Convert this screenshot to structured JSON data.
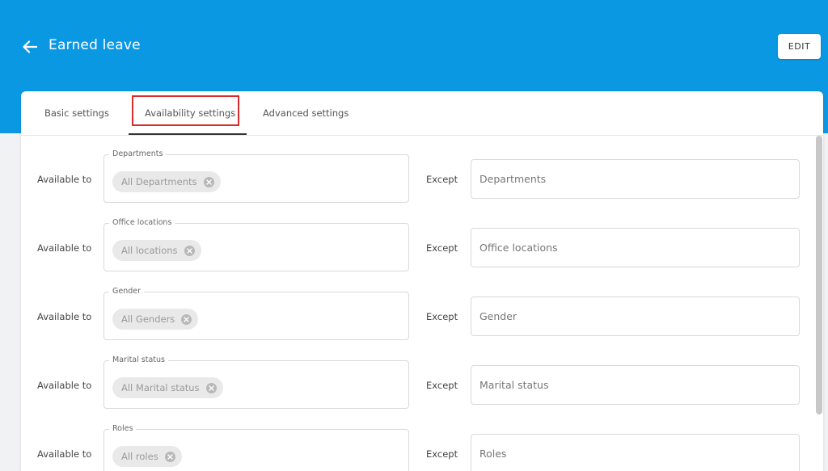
{
  "header": {
    "title": "Earned leave",
    "edit_label": "EDIT",
    "accent": "#0a98e3"
  },
  "tabs": [
    {
      "label": "Basic settings",
      "active": false
    },
    {
      "label": "Availability settings",
      "active": true
    },
    {
      "label": "Advanced settings",
      "active": false
    }
  ],
  "rows": [
    {
      "available_label": "Available to",
      "legend": "Departments",
      "chip": "All Departments",
      "except_label": "Except",
      "except_placeholder": "Departments"
    },
    {
      "available_label": "Available to",
      "legend": "Office locations",
      "chip": "All locations",
      "except_label": "Except",
      "except_placeholder": "Office locations"
    },
    {
      "available_label": "Available to",
      "legend": "Gender",
      "chip": "All Genders",
      "except_label": "Except",
      "except_placeholder": "Gender"
    },
    {
      "available_label": "Available to",
      "legend": "Marital status",
      "chip": "All Marital status",
      "except_label": "Except",
      "except_placeholder": "Marital status"
    },
    {
      "available_label": "Available to",
      "legend": "Roles",
      "chip": "All roles",
      "except_label": "Except",
      "except_placeholder": "Roles"
    }
  ],
  "icons": {
    "back": "arrow-left-icon",
    "chip_remove": "close-circle-icon"
  }
}
